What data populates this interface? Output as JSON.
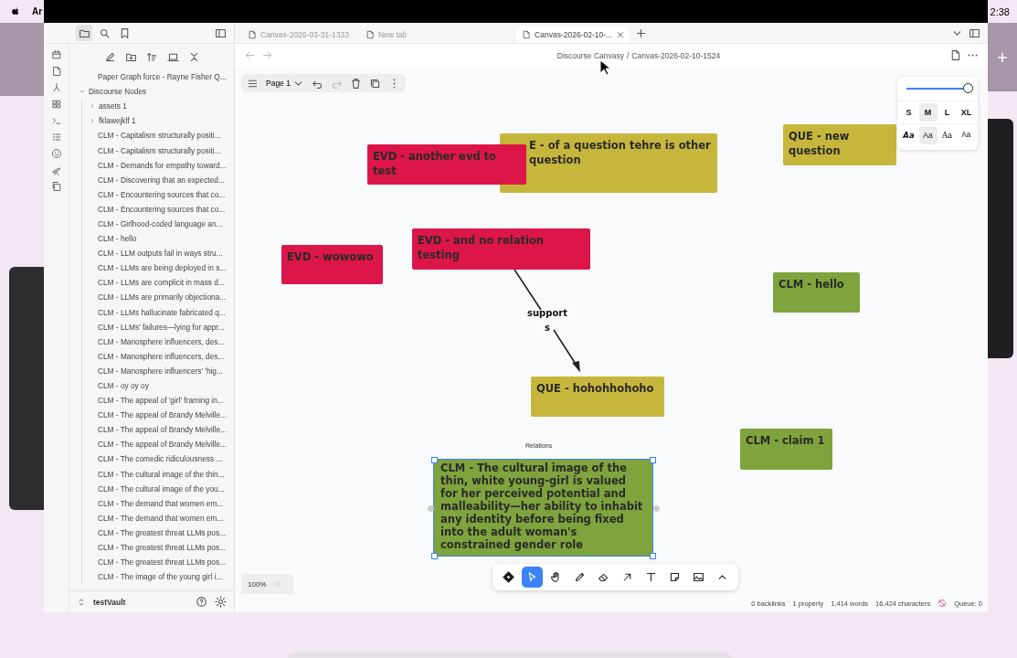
{
  "menubar": {
    "app_name": "Ar",
    "clock": "2:38"
  },
  "left_pane": {
    "nav_tabs": [
      {
        "selected": true
      },
      {
        "selected": false
      },
      {
        "selected": false
      }
    ],
    "files": [
      {
        "name": "Paper Graph force - Rayne Fisher Q...",
        "kind": "file"
      },
      {
        "name": "Discourse Nodes",
        "kind": "folder",
        "expanded": true,
        "children": [
          {
            "name": "assets 1",
            "kind": "folder",
            "expanded": false
          },
          {
            "name": "fklawejklf 1",
            "kind": "folder",
            "expanded": false
          },
          {
            "name": "CLM - Capitalism structurally positi...",
            "kind": "file"
          },
          {
            "name": "CLM - Capitalism structurally positi...",
            "kind": "file"
          },
          {
            "name": "CLM - Demands for empathy toward...",
            "kind": "file"
          },
          {
            "name": "CLM - Discovering that an expected...",
            "kind": "file"
          },
          {
            "name": "CLM - Encountering sources that co...",
            "kind": "file"
          },
          {
            "name": "CLM - Encountering sources that co...",
            "kind": "file"
          },
          {
            "name": "CLM - Girlhood-coded language an...",
            "kind": "file"
          },
          {
            "name": "CLM - hello",
            "kind": "file"
          },
          {
            "name": "CLM - LLM outputs fail in ways stru...",
            "kind": "file"
          },
          {
            "name": "CLM - LLMs are being deployed in s...",
            "kind": "file"
          },
          {
            "name": "CLM - LLMs are complicit in mass d...",
            "kind": "file"
          },
          {
            "name": "CLM - LLMs are primarily objectiona...",
            "kind": "file"
          },
          {
            "name": "CLM - LLMs hallucinate fabricated q...",
            "kind": "file"
          },
          {
            "name": "CLM - LLMs' failures—lying for appr...",
            "kind": "file"
          },
          {
            "name": "CLM - Manosphere influencers, des...",
            "kind": "file"
          },
          {
            "name": "CLM - Manosphere influencers, des...",
            "kind": "file"
          },
          {
            "name": "CLM - Manosphere influencers' 'hig...",
            "kind": "file"
          },
          {
            "name": "CLM - oy oy oy",
            "kind": "file"
          },
          {
            "name": "CLM - The appeal of 'girl' framing in...",
            "kind": "file"
          },
          {
            "name": "CLM - The appeal of Brandy Melville...",
            "kind": "file"
          },
          {
            "name": "CLM - The appeal of Brandy Melville...",
            "kind": "file"
          },
          {
            "name": "CLM - The appeal of Brandy Melville...",
            "kind": "file"
          },
          {
            "name": "CLM - The comedic ridiculousness ...",
            "kind": "file"
          },
          {
            "name": "CLM - The cultural image of the thin...",
            "kind": "file"
          },
          {
            "name": "CLM - The cultural image of the you...",
            "kind": "file"
          },
          {
            "name": "CLM - The demand that women em...",
            "kind": "file"
          },
          {
            "name": "CLM - The demand that women em...",
            "kind": "file"
          },
          {
            "name": "CLM - The greatest threat LLMs pos...",
            "kind": "file"
          },
          {
            "name": "CLM - The greatest threat LLMs pos...",
            "kind": "file"
          },
          {
            "name": "CLM - The greatest threat LLMs pos...",
            "kind": "file"
          },
          {
            "name": "CLM - The image of the young girl i...",
            "kind": "file"
          }
        ]
      }
    ],
    "vault": "testVault"
  },
  "tabs": [
    {
      "label": "Canvas-2026-03-31-1333",
      "selected": false
    },
    {
      "label": "New tab",
      "selected": false
    },
    {
      "label": "Canvas-2026-02-10-...",
      "selected": true
    }
  ],
  "breadcrumb": {
    "parent": "Discourse Canvasy",
    "separator": "/",
    "current": "Canvas-2026-02-10-1524"
  },
  "canvas": {
    "page": "Page 1",
    "nodes": [
      {
        "kind": "que",
        "text": "E - of a question tehre is other question",
        "selected": false
      },
      {
        "kind": "evd",
        "text": "EVD - another evd to test",
        "selected": false
      },
      {
        "kind": "que",
        "text": "QUE - new question",
        "selected": false
      },
      {
        "kind": "evd",
        "text": "EVD - wowowo",
        "selected": false
      },
      {
        "kind": "evd",
        "text": "EVD - and no relation testing",
        "selected": false
      },
      {
        "kind": "clm",
        "text": "CLM - hello",
        "selected": false
      },
      {
        "kind": "que",
        "text": "QUE - hohohhohoho",
        "selected": false
      },
      {
        "kind": "clm",
        "text": "CLM - claim 1",
        "selected": false
      },
      {
        "kind": "clm",
        "text": "CLM - The cultural image of the thin, white young-girl is valued for her perceived potential and malleability—her ability to inhabit any identity before being fixed into the adult woman's constrained gender role",
        "selected": true
      }
    ],
    "edges": [
      {
        "label": "supports"
      }
    ],
    "relations_label": "Relations",
    "style_panel": {
      "level": 1,
      "sizes": [
        {
          "label": "S",
          "selected": false
        },
        {
          "label": "M",
          "selected": true
        },
        {
          "label": "L",
          "selected": false
        },
        {
          "label": "XL",
          "selected": false
        }
      ],
      "fonts": [
        {
          "label": "Aa",
          "selected": false
        },
        {
          "label": "Aa",
          "selected": true
        },
        {
          "label": "Aa",
          "selected": false
        },
        {
          "label": "Aa",
          "selected": false
        }
      ]
    },
    "zoom": "100%",
    "tools": [
      {
        "selected": false
      },
      {
        "selected": true
      },
      {
        "selected": false
      },
      {
        "selected": false
      },
      {
        "selected": false
      },
      {
        "selected": false
      },
      {
        "selected": false
      },
      {
        "selected": false
      },
      {
        "selected": false
      },
      {
        "selected": false
      }
    ]
  },
  "status_bar": [
    "0 backlinks",
    "1 property",
    "1,414 words",
    "16,424 characters",
    "Queue: 0"
  ]
}
